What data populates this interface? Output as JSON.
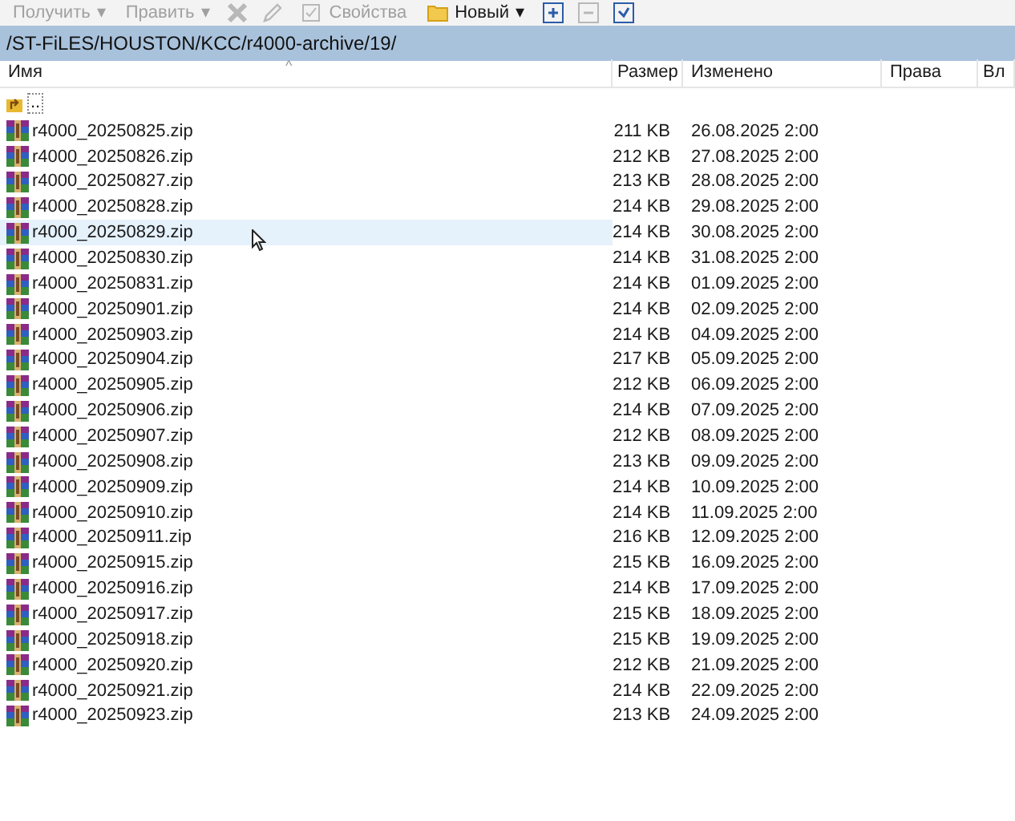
{
  "toolbar": [
    {
      "kind": "button",
      "label": "Получить",
      "disabled": true,
      "dropdown": "▾"
    },
    {
      "kind": "button",
      "label": "Править",
      "disabled": true,
      "dropdown": "▾"
    },
    {
      "kind": "icon",
      "disabled": true
    },
    {
      "kind": "icon",
      "disabled": true
    },
    {
      "kind": "button",
      "label": "Свойства",
      "disabled": true
    },
    {
      "kind": "button",
      "label": "Новый",
      "disabled": false,
      "dropdown": "▾"
    },
    {
      "kind": "icon",
      "disabled": false
    },
    {
      "kind": "icon",
      "disabled": true
    },
    {
      "kind": "icon",
      "disabled": false
    }
  ],
  "path": "/ST-FiLES/HOUSTON/KCC/r4000-archive/19/",
  "sort_indicator": "^",
  "columns": [
    {
      "label": "Имя"
    },
    {
      "label": "Размер"
    },
    {
      "label": "Изменено"
    },
    {
      "label": "Права"
    },
    {
      "label": "Вл"
    }
  ],
  "parent_row": {
    "name": ".."
  },
  "rows": [
    {
      "name": "r4000_20250825.zip",
      "size": "211 KB",
      "modified": "26.08.2025 2:00",
      "hovered": false
    },
    {
      "name": "r4000_20250826.zip",
      "size": "212 KB",
      "modified": "27.08.2025 2:00",
      "hovered": false
    },
    {
      "name": "r4000_20250827.zip",
      "size": "213 KB",
      "modified": "28.08.2025 2:00",
      "hovered": false
    },
    {
      "name": "r4000_20250828.zip",
      "size": "214 KB",
      "modified": "29.08.2025 2:00",
      "hovered": false
    },
    {
      "name": "r4000_20250829.zip",
      "size": "214 KB",
      "modified": "30.08.2025 2:00",
      "hovered": true
    },
    {
      "name": "r4000_20250830.zip",
      "size": "214 KB",
      "modified": "31.08.2025 2:00",
      "hovered": false
    },
    {
      "name": "r4000_20250831.zip",
      "size": "214 KB",
      "modified": "01.09.2025 2:00",
      "hovered": false
    },
    {
      "name": "r4000_20250901.zip",
      "size": "214 KB",
      "modified": "02.09.2025 2:00",
      "hovered": false
    },
    {
      "name": "r4000_20250903.zip",
      "size": "214 KB",
      "modified": "04.09.2025 2:00",
      "hovered": false
    },
    {
      "name": "r4000_20250904.zip",
      "size": "217 KB",
      "modified": "05.09.2025 2:00",
      "hovered": false
    },
    {
      "name": "r4000_20250905.zip",
      "size": "212 KB",
      "modified": "06.09.2025 2:00",
      "hovered": false
    },
    {
      "name": "r4000_20250906.zip",
      "size": "214 KB",
      "modified": "07.09.2025 2:00",
      "hovered": false
    },
    {
      "name": "r4000_20250907.zip",
      "size": "212 KB",
      "modified": "08.09.2025 2:00",
      "hovered": false
    },
    {
      "name": "r4000_20250908.zip",
      "size": "213 KB",
      "modified": "09.09.2025 2:00",
      "hovered": false
    },
    {
      "name": "r4000_20250909.zip",
      "size": "214 KB",
      "modified": "10.09.2025 2:00",
      "hovered": false
    },
    {
      "name": "r4000_20250910.zip",
      "size": "214 KB",
      "modified": "11.09.2025 2:00",
      "hovered": false
    },
    {
      "name": "r4000_20250911.zip",
      "size": "216 KB",
      "modified": "12.09.2025 2:00",
      "hovered": false
    },
    {
      "name": "r4000_20250915.zip",
      "size": "215 KB",
      "modified": "16.09.2025 2:00",
      "hovered": false
    },
    {
      "name": "r4000_20250916.zip",
      "size": "214 KB",
      "modified": "17.09.2025 2:00",
      "hovered": false
    },
    {
      "name": "r4000_20250917.zip",
      "size": "215 KB",
      "modified": "18.09.2025 2:00",
      "hovered": false
    },
    {
      "name": "r4000_20250918.zip",
      "size": "215 KB",
      "modified": "19.09.2025 2:00",
      "hovered": false
    },
    {
      "name": "r4000_20250920.zip",
      "size": "212 KB",
      "modified": "21.09.2025 2:00",
      "hovered": false
    },
    {
      "name": "r4000_20250921.zip",
      "size": "214 KB",
      "modified": "22.09.2025 2:00",
      "hovered": false
    },
    {
      "name": "r4000_20250923.zip",
      "size": "213 KB",
      "modified": "24.09.2025 2:00",
      "hovered": false
    }
  ]
}
